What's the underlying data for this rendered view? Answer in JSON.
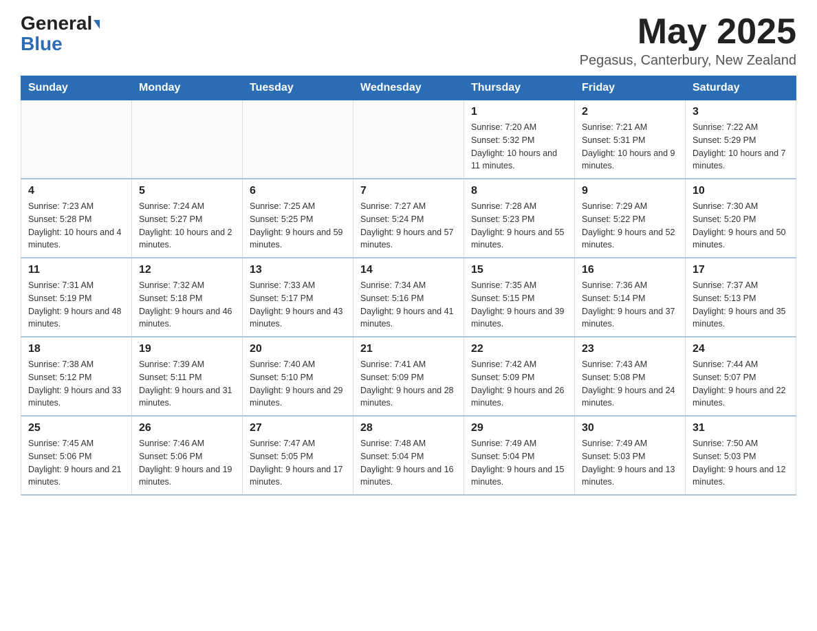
{
  "header": {
    "logo_general": "General",
    "logo_blue": "Blue",
    "month_title": "May 2025",
    "location": "Pegasus, Canterbury, New Zealand"
  },
  "days_of_week": [
    "Sunday",
    "Monday",
    "Tuesday",
    "Wednesday",
    "Thursday",
    "Friday",
    "Saturday"
  ],
  "weeks": [
    [
      {
        "num": "",
        "info": ""
      },
      {
        "num": "",
        "info": ""
      },
      {
        "num": "",
        "info": ""
      },
      {
        "num": "",
        "info": ""
      },
      {
        "num": "1",
        "info": "Sunrise: 7:20 AM\nSunset: 5:32 PM\nDaylight: 10 hours and 11 minutes."
      },
      {
        "num": "2",
        "info": "Sunrise: 7:21 AM\nSunset: 5:31 PM\nDaylight: 10 hours and 9 minutes."
      },
      {
        "num": "3",
        "info": "Sunrise: 7:22 AM\nSunset: 5:29 PM\nDaylight: 10 hours and 7 minutes."
      }
    ],
    [
      {
        "num": "4",
        "info": "Sunrise: 7:23 AM\nSunset: 5:28 PM\nDaylight: 10 hours and 4 minutes."
      },
      {
        "num": "5",
        "info": "Sunrise: 7:24 AM\nSunset: 5:27 PM\nDaylight: 10 hours and 2 minutes."
      },
      {
        "num": "6",
        "info": "Sunrise: 7:25 AM\nSunset: 5:25 PM\nDaylight: 9 hours and 59 minutes."
      },
      {
        "num": "7",
        "info": "Sunrise: 7:27 AM\nSunset: 5:24 PM\nDaylight: 9 hours and 57 minutes."
      },
      {
        "num": "8",
        "info": "Sunrise: 7:28 AM\nSunset: 5:23 PM\nDaylight: 9 hours and 55 minutes."
      },
      {
        "num": "9",
        "info": "Sunrise: 7:29 AM\nSunset: 5:22 PM\nDaylight: 9 hours and 52 minutes."
      },
      {
        "num": "10",
        "info": "Sunrise: 7:30 AM\nSunset: 5:20 PM\nDaylight: 9 hours and 50 minutes."
      }
    ],
    [
      {
        "num": "11",
        "info": "Sunrise: 7:31 AM\nSunset: 5:19 PM\nDaylight: 9 hours and 48 minutes."
      },
      {
        "num": "12",
        "info": "Sunrise: 7:32 AM\nSunset: 5:18 PM\nDaylight: 9 hours and 46 minutes."
      },
      {
        "num": "13",
        "info": "Sunrise: 7:33 AM\nSunset: 5:17 PM\nDaylight: 9 hours and 43 minutes."
      },
      {
        "num": "14",
        "info": "Sunrise: 7:34 AM\nSunset: 5:16 PM\nDaylight: 9 hours and 41 minutes."
      },
      {
        "num": "15",
        "info": "Sunrise: 7:35 AM\nSunset: 5:15 PM\nDaylight: 9 hours and 39 minutes."
      },
      {
        "num": "16",
        "info": "Sunrise: 7:36 AM\nSunset: 5:14 PM\nDaylight: 9 hours and 37 minutes."
      },
      {
        "num": "17",
        "info": "Sunrise: 7:37 AM\nSunset: 5:13 PM\nDaylight: 9 hours and 35 minutes."
      }
    ],
    [
      {
        "num": "18",
        "info": "Sunrise: 7:38 AM\nSunset: 5:12 PM\nDaylight: 9 hours and 33 minutes."
      },
      {
        "num": "19",
        "info": "Sunrise: 7:39 AM\nSunset: 5:11 PM\nDaylight: 9 hours and 31 minutes."
      },
      {
        "num": "20",
        "info": "Sunrise: 7:40 AM\nSunset: 5:10 PM\nDaylight: 9 hours and 29 minutes."
      },
      {
        "num": "21",
        "info": "Sunrise: 7:41 AM\nSunset: 5:09 PM\nDaylight: 9 hours and 28 minutes."
      },
      {
        "num": "22",
        "info": "Sunrise: 7:42 AM\nSunset: 5:09 PM\nDaylight: 9 hours and 26 minutes."
      },
      {
        "num": "23",
        "info": "Sunrise: 7:43 AM\nSunset: 5:08 PM\nDaylight: 9 hours and 24 minutes."
      },
      {
        "num": "24",
        "info": "Sunrise: 7:44 AM\nSunset: 5:07 PM\nDaylight: 9 hours and 22 minutes."
      }
    ],
    [
      {
        "num": "25",
        "info": "Sunrise: 7:45 AM\nSunset: 5:06 PM\nDaylight: 9 hours and 21 minutes."
      },
      {
        "num": "26",
        "info": "Sunrise: 7:46 AM\nSunset: 5:06 PM\nDaylight: 9 hours and 19 minutes."
      },
      {
        "num": "27",
        "info": "Sunrise: 7:47 AM\nSunset: 5:05 PM\nDaylight: 9 hours and 17 minutes."
      },
      {
        "num": "28",
        "info": "Sunrise: 7:48 AM\nSunset: 5:04 PM\nDaylight: 9 hours and 16 minutes."
      },
      {
        "num": "29",
        "info": "Sunrise: 7:49 AM\nSunset: 5:04 PM\nDaylight: 9 hours and 15 minutes."
      },
      {
        "num": "30",
        "info": "Sunrise: 7:49 AM\nSunset: 5:03 PM\nDaylight: 9 hours and 13 minutes."
      },
      {
        "num": "31",
        "info": "Sunrise: 7:50 AM\nSunset: 5:03 PM\nDaylight: 9 hours and 12 minutes."
      }
    ]
  ]
}
